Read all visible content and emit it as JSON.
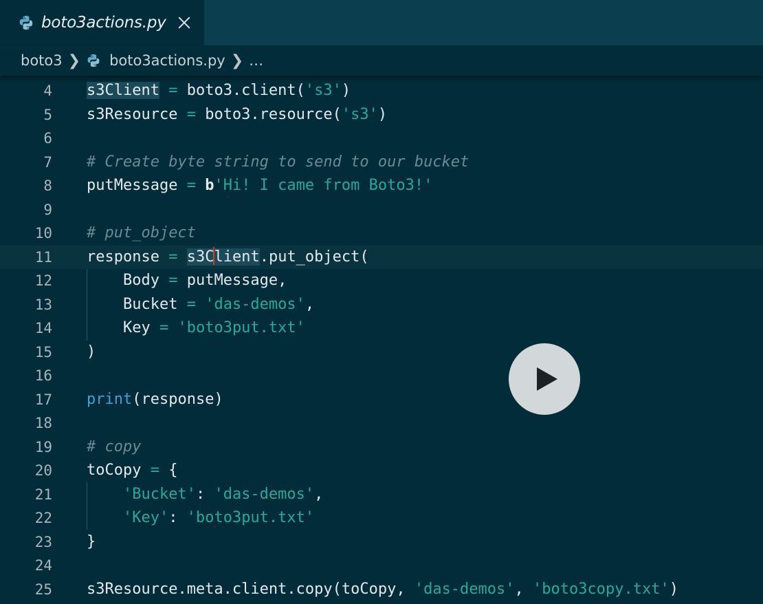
{
  "tab": {
    "filename": "boto3actions.py"
  },
  "breadcrumb": {
    "root": "boto3",
    "file": "boto3actions.py",
    "more": "…"
  },
  "icons": {
    "python": "python-file-icon",
    "close": "close-icon",
    "play": "play-icon",
    "chevron": "chevron-right-icon"
  },
  "colors": {
    "background": "#022c39",
    "tab_bar": "#0b3f50",
    "string": "#2aa89a",
    "comment": "#6b8a93",
    "keyword_fn": "#4a9bd9",
    "cursor": "#e0342c"
  },
  "lines": [
    {
      "n": "4",
      "parts": [
        [
          "hl",
          "s3Client"
        ],
        [
          "t",
          " "
        ],
        [
          "op",
          "="
        ],
        [
          "t",
          " boto3.client("
        ],
        [
          "s",
          "'s3'"
        ],
        [
          "t",
          ")"
        ]
      ]
    },
    {
      "n": "5",
      "parts": [
        [
          "t",
          "s3Resource "
        ],
        [
          "op",
          "="
        ],
        [
          "t",
          " boto3.resource("
        ],
        [
          "s",
          "'s3'"
        ],
        [
          "t",
          ")"
        ]
      ]
    },
    {
      "n": "6",
      "parts": []
    },
    {
      "n": "7",
      "parts": [
        [
          "c",
          "# Create byte string to send to our bucket"
        ]
      ]
    },
    {
      "n": "8",
      "parts": [
        [
          "t",
          "putMessage "
        ],
        [
          "op",
          "="
        ],
        [
          "t",
          " "
        ],
        [
          "b",
          "b"
        ],
        [
          "s",
          "'Hi! I came from Boto3!'"
        ]
      ]
    },
    {
      "n": "9",
      "parts": []
    },
    {
      "n": "10",
      "parts": [
        [
          "c",
          "# put_object"
        ]
      ]
    },
    {
      "n": "11",
      "current": true,
      "parts": [
        [
          "t",
          "response "
        ],
        [
          "op",
          "="
        ],
        [
          "t",
          " "
        ],
        [
          "hl",
          "s3C"
        ],
        [
          "cursor",
          ""
        ],
        [
          "hl",
          "lient"
        ],
        [
          "t",
          ".put_object("
        ]
      ]
    },
    {
      "n": "12",
      "parts": [
        [
          "t",
          "    Body "
        ],
        [
          "op",
          "="
        ],
        [
          "t",
          " putMessage,"
        ]
      ]
    },
    {
      "n": "13",
      "parts": [
        [
          "t",
          "    Bucket "
        ],
        [
          "op",
          "="
        ],
        [
          "t",
          " "
        ],
        [
          "s",
          "'das-demos'"
        ],
        [
          "t",
          ","
        ]
      ]
    },
    {
      "n": "14",
      "parts": [
        [
          "t",
          "    Key "
        ],
        [
          "op",
          "="
        ],
        [
          "t",
          " "
        ],
        [
          "s",
          "'boto3put.txt'"
        ]
      ]
    },
    {
      "n": "15",
      "parts": [
        [
          "t",
          ")"
        ]
      ]
    },
    {
      "n": "16",
      "parts": []
    },
    {
      "n": "17",
      "parts": [
        [
          "f",
          "print"
        ],
        [
          "t",
          "(response)"
        ]
      ]
    },
    {
      "n": "18",
      "parts": []
    },
    {
      "n": "19",
      "parts": [
        [
          "c",
          "# copy"
        ]
      ]
    },
    {
      "n": "20",
      "parts": [
        [
          "t",
          "toCopy "
        ],
        [
          "op",
          "="
        ],
        [
          "t",
          " {"
        ]
      ]
    },
    {
      "n": "21",
      "parts": [
        [
          "t",
          "    "
        ],
        [
          "s",
          "'Bucket'"
        ],
        [
          "t",
          ": "
        ],
        [
          "s",
          "'das-demos'"
        ],
        [
          "t",
          ","
        ]
      ]
    },
    {
      "n": "22",
      "parts": [
        [
          "t",
          "    "
        ],
        [
          "s",
          "'Key'"
        ],
        [
          "t",
          ": "
        ],
        [
          "s",
          "'boto3put.txt'"
        ]
      ]
    },
    {
      "n": "23",
      "parts": [
        [
          "t",
          "}"
        ]
      ]
    },
    {
      "n": "24",
      "parts": []
    },
    {
      "n": "25",
      "parts": [
        [
          "t",
          "s3Resource.meta.client.copy(toCopy, "
        ],
        [
          "s",
          "'das-demos'"
        ],
        [
          "t",
          ", "
        ],
        [
          "s",
          "'boto3copy.txt'"
        ],
        [
          "t",
          ")"
        ]
      ]
    }
  ]
}
